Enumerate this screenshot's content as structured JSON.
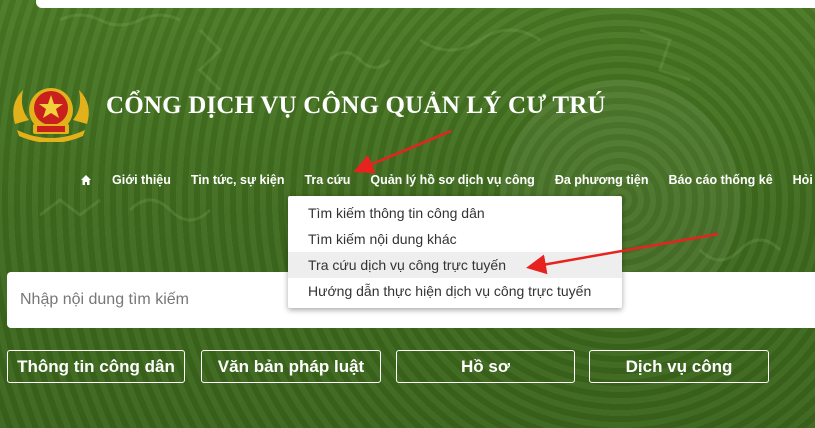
{
  "header": {
    "title": "CỔNG DỊCH VỤ CÔNG QUẢN LÝ CƯ TRÚ",
    "emblem_icon": "police-emblem-icon"
  },
  "nav": {
    "home_icon": "home-icon",
    "items": [
      {
        "label": "Giới thiệu"
      },
      {
        "label": "Tin tức, sự kiện"
      },
      {
        "label": "Tra cứu"
      },
      {
        "label": "Quản lý hồ sơ dịch vụ công"
      },
      {
        "label": "Đa phương tiện"
      },
      {
        "label": "Báo cáo thống kê"
      },
      {
        "label": "Hỏi đáp"
      }
    ]
  },
  "dropdown": {
    "items": [
      {
        "label": "Tìm kiếm thông tin công dân"
      },
      {
        "label": "Tìm kiếm nội dung khác"
      },
      {
        "label": "Tra cứu dịch vụ công trực tuyến",
        "highlighted": true
      },
      {
        "label": "Hướng dẫn thực hiện dịch vụ công trực tuyến"
      }
    ]
  },
  "search": {
    "placeholder": "Nhập nội dung tìm kiếm",
    "value": ""
  },
  "quick_buttons": [
    {
      "label": "Thông tin công dân"
    },
    {
      "label": "Văn bản pháp luật"
    },
    {
      "label": "Hồ sơ"
    },
    {
      "label": "Dịch vụ công"
    }
  ],
  "colors": {
    "background": "#3e6a1f",
    "annotation_arrow": "#e8231f",
    "emblem_gold": "#e3b21b",
    "emblem_red": "#c8201d"
  }
}
